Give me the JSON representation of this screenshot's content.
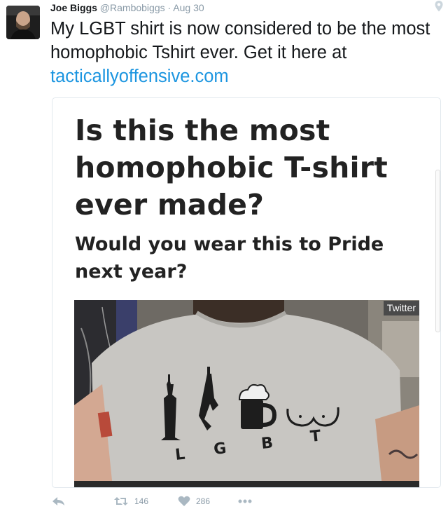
{
  "tweet": {
    "name": "Joe Biggs",
    "handle": "@Rambobiggs",
    "separator": "·",
    "date": "Aug 30",
    "text": "My LGBT shirt is now considered to be the most homophobic Tshirt ever. Get it here at",
    "link": "tacticallyoffensive.com",
    "location_icon": "map-pin-icon"
  },
  "card": {
    "headline": "Is this the most homophobic T-shirt ever made?",
    "subheadline": "Would you wear this to Pride next year?",
    "image_badge": "Twitter",
    "shirt_letters": [
      "L",
      "G",
      "B",
      "T"
    ]
  },
  "actions": {
    "reply_icon": "reply-icon",
    "retweet_icon": "retweet-icon",
    "retweet_count": "146",
    "like_icon": "heart-icon",
    "like_count": "286",
    "more_icon": "more-icon"
  },
  "colors": {
    "link": "#1b95e0",
    "muted": "#8899a6",
    "icon": "#aab8c2",
    "headline": "#222222"
  }
}
